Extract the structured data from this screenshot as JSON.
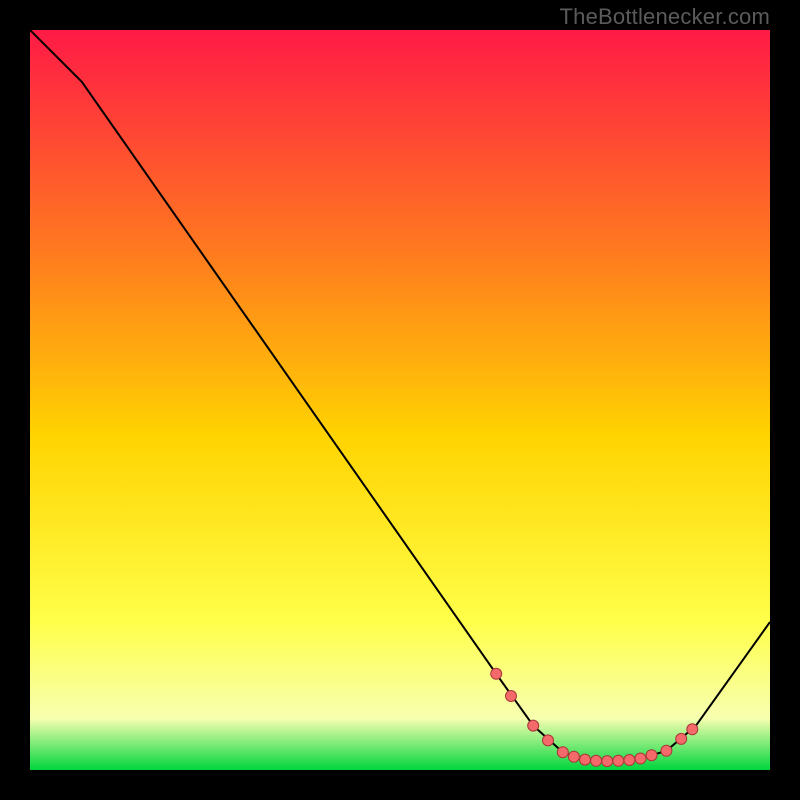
{
  "watermark": "TheBottlenecker.com",
  "colors": {
    "gradient_top": "#ff1a46",
    "gradient_mid1": "#ff7a1f",
    "gradient_mid2": "#ffd400",
    "gradient_mid3": "#ffff4a",
    "gradient_mid4": "#f7ffb0",
    "gradient_bottom": "#00d63d",
    "curve": "#000000",
    "marker_fill": "#f46a6a",
    "marker_stroke": "#a83838"
  },
  "chart_data": {
    "type": "line",
    "title": "",
    "xlabel": "",
    "ylabel": "",
    "xlim": [
      0,
      100
    ],
    "ylim": [
      0,
      100
    ],
    "curve": [
      {
        "x": 0,
        "y": 100
      },
      {
        "x": 7,
        "y": 93
      },
      {
        "x": 63,
        "y": 13
      },
      {
        "x": 68,
        "y": 6
      },
      {
        "x": 72,
        "y": 2.4
      },
      {
        "x": 75,
        "y": 1.4
      },
      {
        "x": 78,
        "y": 1.2
      },
      {
        "x": 82,
        "y": 1.4
      },
      {
        "x": 86,
        "y": 2.6
      },
      {
        "x": 90,
        "y": 6
      },
      {
        "x": 100,
        "y": 20
      }
    ],
    "markers": [
      {
        "x": 63,
        "y": 13
      },
      {
        "x": 65,
        "y": 10
      },
      {
        "x": 68,
        "y": 6
      },
      {
        "x": 70,
        "y": 4
      },
      {
        "x": 72,
        "y": 2.4
      },
      {
        "x": 73.5,
        "y": 1.8
      },
      {
        "x": 75,
        "y": 1.4
      },
      {
        "x": 76.5,
        "y": 1.25
      },
      {
        "x": 78,
        "y": 1.2
      },
      {
        "x": 79.5,
        "y": 1.25
      },
      {
        "x": 81,
        "y": 1.35
      },
      {
        "x": 82.5,
        "y": 1.55
      },
      {
        "x": 84,
        "y": 2.0
      },
      {
        "x": 86,
        "y": 2.6
      },
      {
        "x": 88,
        "y": 4.2
      },
      {
        "x": 89.5,
        "y": 5.5
      }
    ]
  }
}
